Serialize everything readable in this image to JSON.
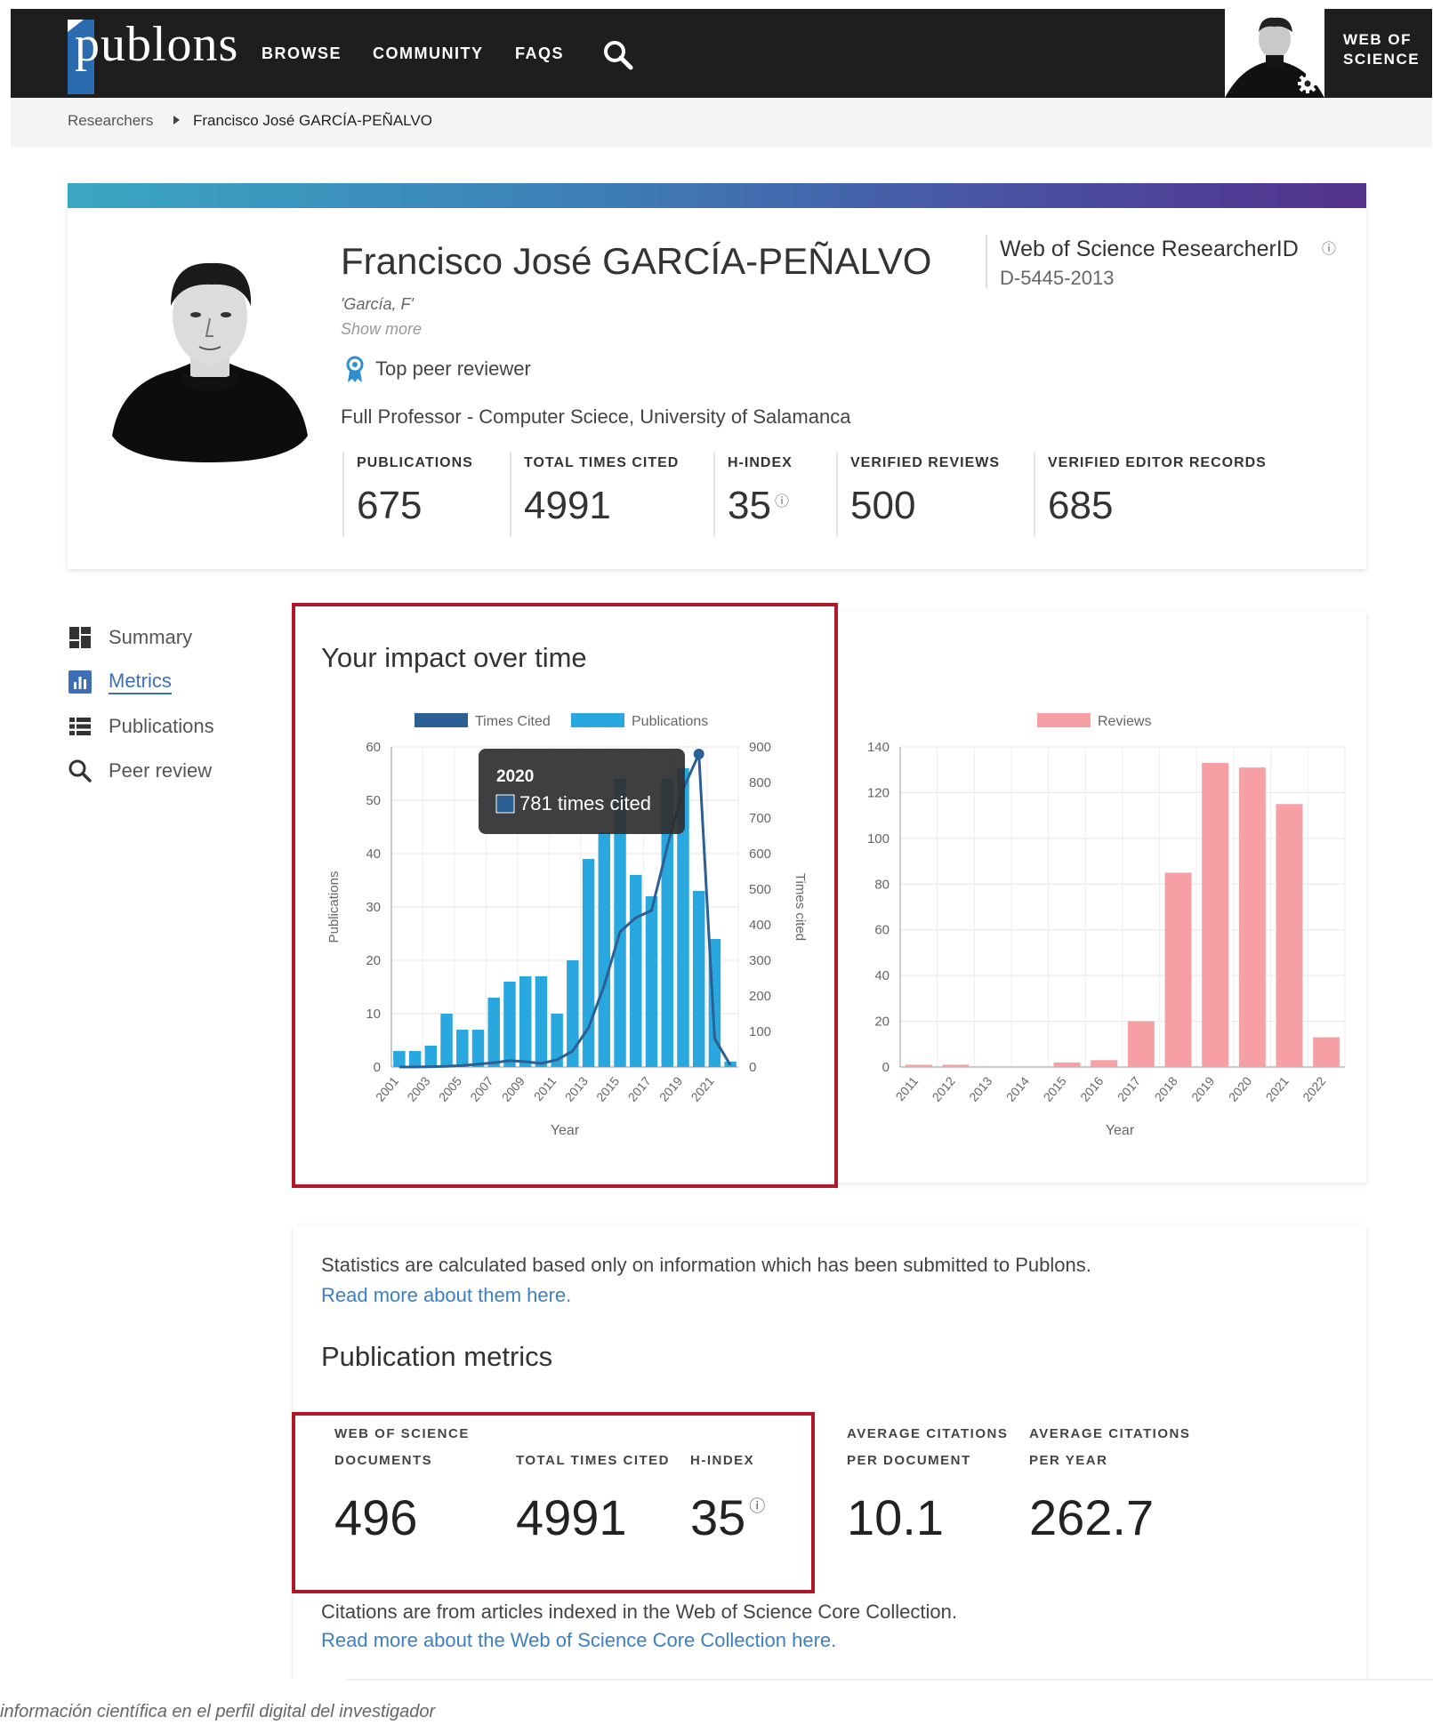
{
  "nav": {
    "logo": "publons",
    "browse": "BROWSE",
    "community": "COMMUNITY",
    "faqs": "FAQS",
    "wos_line1": "WEB OF",
    "wos_line2": "SCIENCE"
  },
  "breadcrumb": {
    "parent": "Researchers",
    "current": "Francisco José GARCÍA-PEÑALVO"
  },
  "profile": {
    "name": "Francisco José GARCÍA-PEÑALVO",
    "alias": "'García, F'",
    "show_more": "Show more",
    "badge": "Top peer reviewer",
    "position": "Full Professor - Computer Sciece, University of Salamanca",
    "researcher_id_label": "Web of Science ResearcherID",
    "researcher_id": "D-5445-2013",
    "help": "?",
    "stats": [
      {
        "label": "PUBLICATIONS",
        "value": "675"
      },
      {
        "label": "TOTAL TIMES CITED",
        "value": "4991"
      },
      {
        "label": "H-INDEX",
        "value": "35"
      },
      {
        "label": "VERIFIED REVIEWS",
        "value": "500"
      },
      {
        "label": "VERIFIED EDITOR RECORDS",
        "value": "685"
      }
    ]
  },
  "sidebar": {
    "items": [
      {
        "label": "Summary"
      },
      {
        "label": "Metrics"
      },
      {
        "label": "Publications"
      },
      {
        "label": "Peer review"
      }
    ]
  },
  "impact": {
    "title": "Your impact over time",
    "tooltip_year": "2020",
    "tooltip_text": "781 times cited"
  },
  "chart_data": [
    {
      "type": "bar",
      "title": "",
      "xlabel": "Year",
      "ylabel": "Publications",
      "y2label": "Times cited",
      "legend": [
        "Times Cited",
        "Publications"
      ],
      "legend_position": "top",
      "ylim": [
        0,
        60
      ],
      "y2lim": [
        0,
        900
      ],
      "yticks": [
        "0",
        "10",
        "20",
        "30",
        "40",
        "50",
        "60"
      ],
      "y2ticks": [
        "0",
        "100",
        "200",
        "300",
        "400",
        "500",
        "600",
        "700",
        "800",
        "900"
      ],
      "xticks": [
        "2001",
        "2003",
        "2005",
        "2007",
        "2009",
        "2011",
        "2013",
        "2015",
        "2017",
        "2019",
        "2021"
      ],
      "categories": [
        "2001",
        "2002",
        "2003",
        "2004",
        "2005",
        "2006",
        "2007",
        "2008",
        "2009",
        "2010",
        "2011",
        "2012",
        "2013",
        "2014",
        "2015",
        "2016",
        "2017",
        "2018",
        "2019",
        "2020",
        "2021",
        "2022"
      ],
      "series": [
        {
          "name": "Publications",
          "kind": "bar",
          "color": "#29a8e0",
          "values": [
            3,
            3,
            4,
            10,
            7,
            7,
            13,
            16,
            17,
            17,
            10,
            20,
            39,
            44,
            54,
            36,
            32,
            54,
            56,
            33,
            24,
            1
          ]
        },
        {
          "name": "Times Cited",
          "kind": "line",
          "color": "#2c5f93",
          "values": [
            0,
            0,
            1,
            2,
            4,
            8,
            12,
            18,
            15,
            10,
            20,
            45,
            110,
            230,
            380,
            420,
            440,
            620,
            781,
            880,
            80,
            5
          ]
        }
      ]
    },
    {
      "type": "bar",
      "title": "",
      "xlabel": "Year",
      "ylabel": "",
      "legend": [
        "Reviews"
      ],
      "legend_position": "top",
      "ylim": [
        0,
        140
      ],
      "yticks": [
        "0",
        "20",
        "40",
        "60",
        "80",
        "100",
        "120",
        "140"
      ],
      "categories": [
        "2011",
        "2012",
        "2013",
        "2014",
        "2015",
        "2016",
        "2017",
        "2018",
        "2019",
        "2020",
        "2021",
        "2022"
      ],
      "series": [
        {
          "name": "Reviews",
          "kind": "bar",
          "color": "#f6a0a6",
          "values": [
            1,
            1,
            0,
            0,
            2,
            3,
            20,
            85,
            133,
            131,
            115,
            13
          ]
        }
      ]
    }
  ],
  "stats": {
    "note": "Statistics are calculated based only on information which has been submitted to Publons.",
    "read_more": "Read more about them here.",
    "pub_metrics_title": "Publication metrics",
    "metrics": [
      {
        "label1": "WEB OF SCIENCE",
        "label2": "DOCUMENTS",
        "value": "496"
      },
      {
        "label1": "",
        "label2": "TOTAL TIMES CITED",
        "value": "4991"
      },
      {
        "label1": "",
        "label2": "H-INDEX",
        "value": "35"
      },
      {
        "label1": "AVERAGE CITATIONS",
        "label2": "PER DOCUMENT",
        "value": "10.1"
      },
      {
        "label1": "AVERAGE CITATIONS",
        "label2": "PER YEAR",
        "value": "262.7"
      }
    ],
    "cite_note": "Citations are from articles indexed in the Web of Science Core Collection.",
    "read_more_core": "Read more about the Web of Science Core Collection here."
  },
  "footer": {
    "text": "información científica en el perfil digital del investigador"
  },
  "colors": {
    "accent_blue": "#3d7fc4",
    "highlight_red": "#b0182a",
    "pub_bar": "#29a8e0",
    "cited_line": "#2c5f93",
    "review_bar": "#f6a0a6"
  }
}
